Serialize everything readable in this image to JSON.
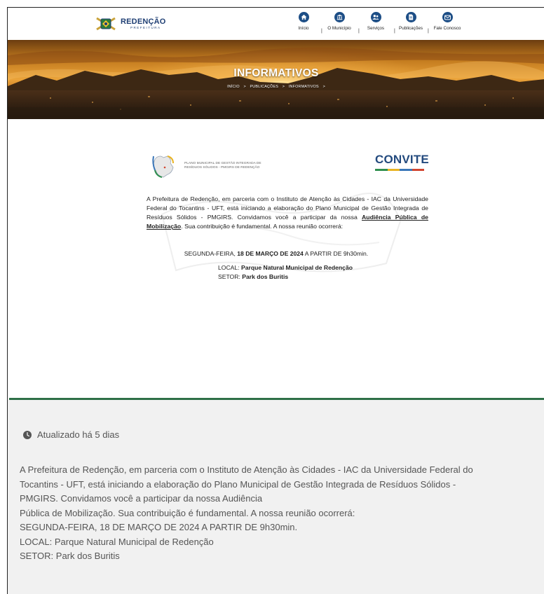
{
  "header": {
    "logo_text": "REDENÇÃO",
    "logo_sub": "PREFEITURA",
    "nav": [
      {
        "label": "Início",
        "icon": "home-icon"
      },
      {
        "label": "O Município",
        "icon": "bank-icon"
      },
      {
        "label": "Serviços",
        "icon": "users-icon"
      },
      {
        "label": "Publicações",
        "icon": "document-icon"
      },
      {
        "label": "Fale Conosco",
        "icon": "mail-icon"
      }
    ],
    "separator": "|"
  },
  "banner": {
    "title": "INFORMATIVOS",
    "breadcrumb": [
      "INÍCIO",
      "PUBLICAÇÕES",
      "INFORMATIVOS"
    ],
    "breadcrumb_sep": ">"
  },
  "invite": {
    "plan_line1": "PLANO MUNICIPAL DE GESTÃO INTEGRADA DE",
    "plan_line2": "RESÍDUOS SÓLIDOS - PMGIRS DE REDENÇÃO",
    "heading": "CONVITE",
    "para_part1": "A Prefeitura de Redenção, em parceria com o Instituto de Atenção às Cidades - IAC da Universidade Federal do Tocantins - UFT, está iniciando a elaboração do Plano Municipal de Gestão Integrada de Resíduos Sólidos - PMGIRS. Convidamos você a participar da nossa ",
    "para_bold": "Audiência Pública de Mobilização",
    "para_part2": ". Sua contribuição é fundamental. A nossa reunião ocorrerá:",
    "date_pre": "SEGUNDA-FEIRA, ",
    "date_bold": "18 DE MARÇO DE 2024",
    "date_post": " A PARTIR DE 9h30min.",
    "local_label": "LOCAL: ",
    "local_value": "Parque Natural Municipal de Redenção",
    "setor_label": "SETOR: ",
    "setor_value": "Park dos Buritis",
    "bar_colors": [
      "#2f8f4e",
      "#e9b424",
      "#3a76b8",
      "#d2452f"
    ]
  },
  "info": {
    "updated": "Atualizado há 5 dias",
    "lines": [
      "A Prefeitura de Redenção, em parceria com o Instituto de Atenção às Cidades - IAC da Universidade Federal do",
      "Tocantins - UFT, está iniciando a elaboração do Plano Municipal de Gestão Integrada de Resíduos Sólidos -",
      "PMGIRS. Convidamos você a participar da nossa Audiência",
      "Pública de Mobilização. Sua contribuição é fundamental. A nossa reunião ocorrerá:",
      "SEGUNDA-FEIRA, 18 DE MARÇO DE 2024 A PARTIR DE 9h30min.",
      "LOCAL: Parque Natural Municipal de Redenção",
      "SETOR: Park dos Buritis"
    ]
  },
  "colors": {
    "nav_icon": "#1d4e86",
    "accent_green": "#2e7048",
    "convite_blue": "#234a7e"
  }
}
